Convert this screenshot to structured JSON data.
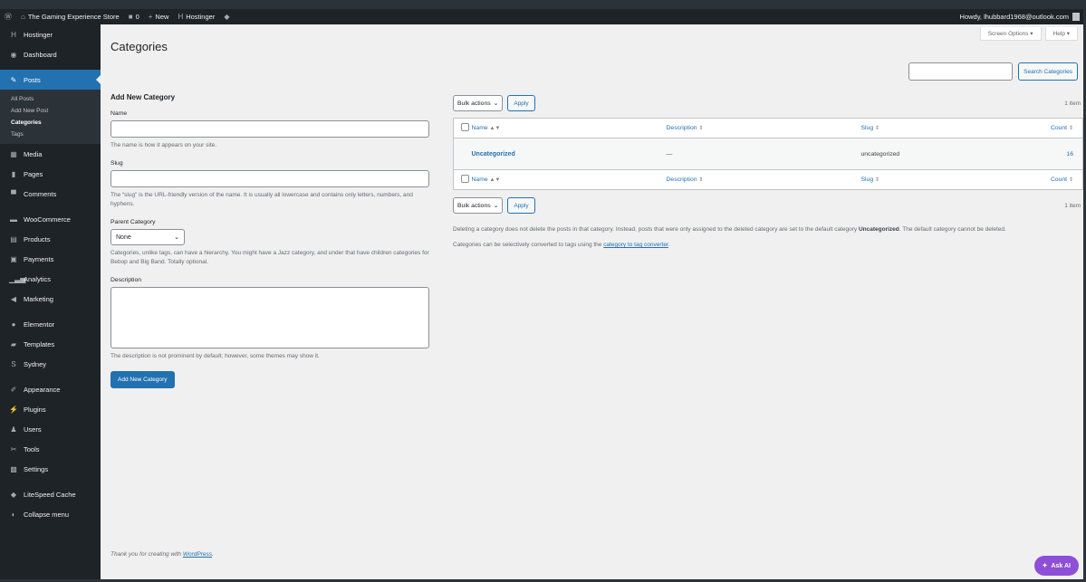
{
  "admin_bar": {
    "wp_logo_icon": "wordpress-icon",
    "site_name": "The Gaming Experience Store",
    "comments_count": "0",
    "new_label": "New",
    "hostinger_label": "Hostinger",
    "howdy": "Howdy, lhubbard1968@outlook.com"
  },
  "sidebar": {
    "items": [
      {
        "label": "Hostinger",
        "icon": "hostinger-icon"
      },
      {
        "label": "Dashboard",
        "icon": "dashboard-icon"
      },
      {
        "label": "Posts",
        "icon": "pin-icon"
      },
      {
        "label": "Media",
        "icon": "media-icon"
      },
      {
        "label": "Pages",
        "icon": "pages-icon"
      },
      {
        "label": "Comments",
        "icon": "comments-icon"
      },
      {
        "label": "WooCommerce",
        "icon": "woocommerce-icon"
      },
      {
        "label": "Products",
        "icon": "products-icon"
      },
      {
        "label": "Payments",
        "icon": "payments-icon"
      },
      {
        "label": "Analytics",
        "icon": "analytics-icon"
      },
      {
        "label": "Marketing",
        "icon": "marketing-icon"
      },
      {
        "label": "Elementor",
        "icon": "elementor-icon"
      },
      {
        "label": "Templates",
        "icon": "templates-icon"
      },
      {
        "label": "Sydney",
        "icon": "sydney-icon"
      },
      {
        "label": "Appearance",
        "icon": "appearance-icon"
      },
      {
        "label": "Plugins",
        "icon": "plugins-icon"
      },
      {
        "label": "Users",
        "icon": "users-icon"
      },
      {
        "label": "Tools",
        "icon": "tools-icon"
      },
      {
        "label": "Settings",
        "icon": "settings-icon"
      },
      {
        "label": "LiteSpeed Cache",
        "icon": "litespeed-icon"
      },
      {
        "label": "Collapse menu",
        "icon": "collapse-icon"
      }
    ],
    "submenu": [
      "All Posts",
      "Add New Post",
      "Categories",
      "Tags"
    ]
  },
  "header": {
    "screen_options": "Screen Options ▾",
    "help": "Help ▾",
    "title": "Categories",
    "search_button": "Search Categories",
    "search_value": ""
  },
  "form": {
    "heading": "Add New Category",
    "name_label": "Name",
    "name_value": "",
    "name_help": "The name is how it appears on your site.",
    "slug_label": "Slug",
    "slug_value": "",
    "slug_help": "The “slug” is the URL-friendly version of the name. It is usually all lowercase and contains only letters, numbers, and hyphens.",
    "parent_label": "Parent Category",
    "parent_value": "None",
    "parent_help": "Categories, unlike tags, can have a hierarchy. You might have a Jazz category, and under that have children categories for Bebop and Big Band. Totally optional.",
    "description_label": "Description",
    "description_value": "",
    "description_help": "The description is not prominent by default; however, some themes may show it.",
    "submit": "Add New Category"
  },
  "table": {
    "bulk_actions": "Bulk actions",
    "apply": "Apply",
    "item_count": "1 item",
    "columns": [
      "Name",
      "Description",
      "Slug",
      "Count"
    ],
    "rows": [
      {
        "name": "Uncategorized",
        "description": "—",
        "slug": "uncategorized",
        "count": "16"
      }
    ]
  },
  "notes": {
    "line1_a": "Deleting a category does not delete the posts in that category. Instead, posts that were only assigned to the deleted category are set to the default category ",
    "line1_b": "Uncategorized",
    "line1_c": ". The default category cannot be deleted.",
    "line2_a": "Categories can be selectively converted to tags using the ",
    "line2_link": "category to tag converter",
    "line2_c": "."
  },
  "footer": {
    "text": "Thank you for creating with ",
    "link": "WordPress",
    "end": "."
  },
  "ask_ai": "Ask AI",
  "colors": {
    "admin_bar": "#1d2327",
    "accent": "#2271b1",
    "background": "#f0f0f1",
    "ask_ai": "#8e4fd8"
  }
}
